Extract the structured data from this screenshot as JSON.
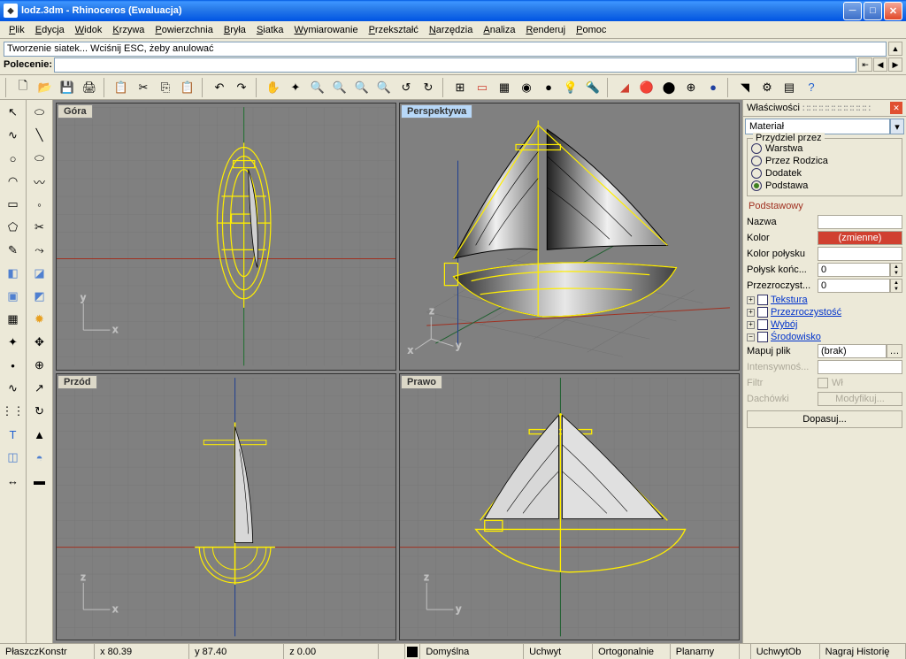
{
  "window": {
    "title": "lodz.3dm - Rhinoceros (Ewaluacja)"
  },
  "menu": [
    "Plik",
    "Edycja",
    "Widok",
    "Krzywa",
    "Powierzchnia",
    "Bryła",
    "Siatka",
    "Wymiarowanie",
    "Przekształć",
    "Narzędzia",
    "Analiza",
    "Renderuj",
    "Pomoc"
  ],
  "command": {
    "history": "Tworzenie siatek... Wciśnij ESC, żeby anulować",
    "prompt_label": "Polecenie:",
    "prompt_value": ""
  },
  "viewports": {
    "top": "Góra",
    "perspective": "Perspektywa",
    "front": "Przód",
    "right": "Prawo"
  },
  "properties": {
    "panel_title": "Właściwości",
    "dropdown": "Materiał",
    "assign_group": "Przydziel przez",
    "radios": [
      "Warstwa",
      "Przez Rodzica",
      "Dodatek",
      "Podstawa"
    ],
    "radio_checked": 3,
    "basic_hdr": "Podstawowy",
    "rows": {
      "name_lbl": "Nazwa",
      "name_val": "",
      "color_lbl": "Kolor",
      "color_val": "(zmienne)",
      "gloss_color_lbl": "Kolor połysku",
      "gloss_color_val": "",
      "gloss_end_lbl": "Połysk końc...",
      "gloss_end_val": "0",
      "transp_lbl": "Przezroczyst...",
      "transp_val": "0"
    },
    "tree": [
      "Tekstura",
      "Przezroczystość",
      "Wybój",
      "Środowisko"
    ],
    "env": {
      "map_lbl": "Mapuj plik",
      "map_val": "(brak)",
      "intensity_lbl": "Intensywnoś...",
      "intensity_val": "",
      "filter_lbl": "Filtr",
      "filter_cb": "Wł",
      "tiles_lbl": "Dachówki",
      "tiles_btn": "Modyfikuj..."
    },
    "fit_btn": "Dopasuj..."
  },
  "statusbar": {
    "cplane": "PłaszczKonstr",
    "x": "x 80.39",
    "y": "y 87.40",
    "z": "z 0.00",
    "layer": "Domyślna",
    "toggles": [
      "Uchwyt",
      "Ortogonalnie",
      "Planarny",
      "UchwytOb",
      "Nagraj Historię"
    ]
  }
}
